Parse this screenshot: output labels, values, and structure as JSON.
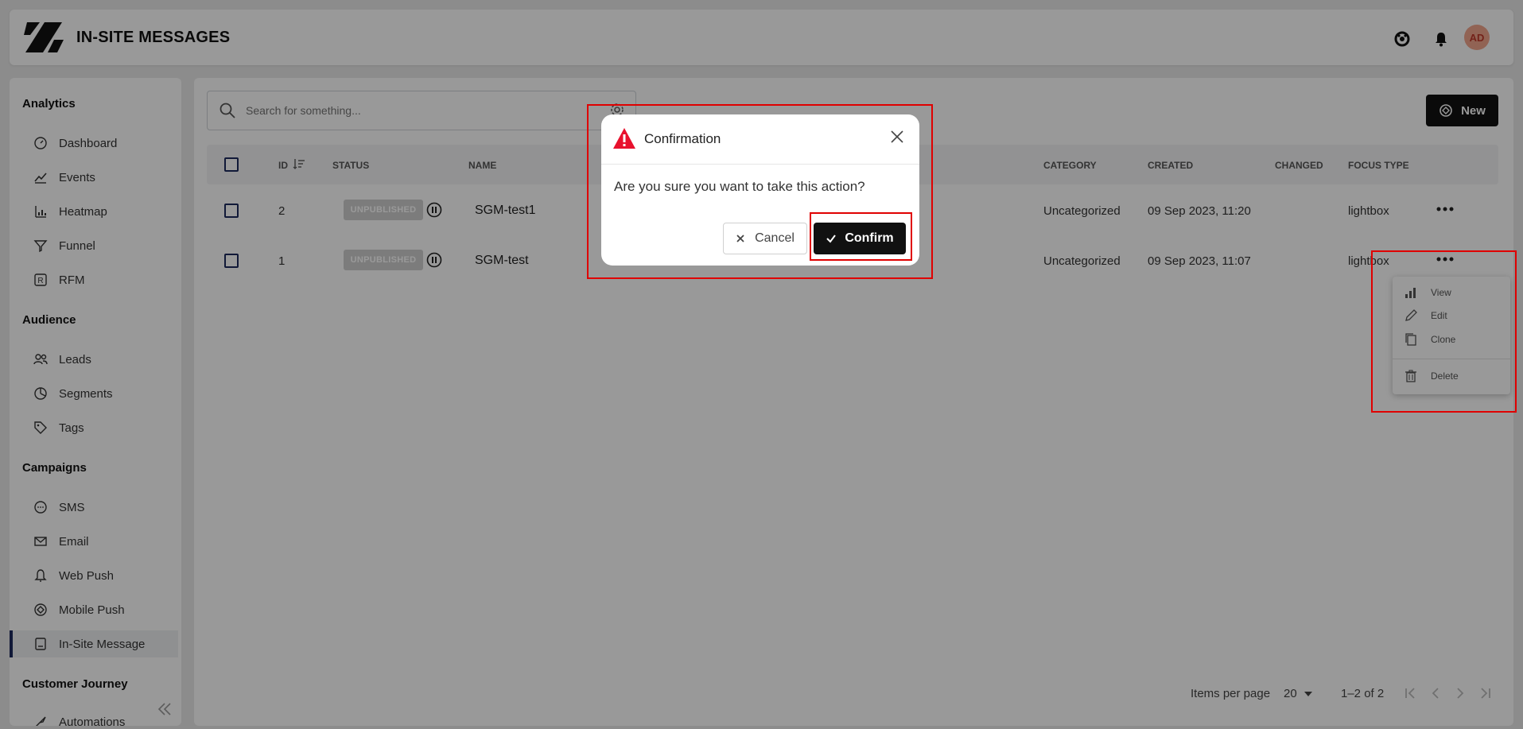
{
  "header": {
    "title": "IN-SITE MESSAGES",
    "avatar_initials": "AD"
  },
  "sidebar": {
    "sections": [
      {
        "title": "Analytics",
        "items": [
          "Dashboard",
          "Events",
          "Heatmap",
          "Funnel",
          "RFM"
        ]
      },
      {
        "title": "Audience",
        "items": [
          "Leads",
          "Segments",
          "Tags"
        ]
      },
      {
        "title": "Campaigns",
        "items": [
          "SMS",
          "Email",
          "Web Push",
          "Mobile Push",
          "In-Site Message"
        ]
      },
      {
        "title": "Customer Journey",
        "items": [
          "Automations"
        ]
      }
    ],
    "active_item": "In-Site Message"
  },
  "toolbar": {
    "search_placeholder": "Search for something...",
    "new_label": "New"
  },
  "table": {
    "columns": [
      "ID",
      "STATUS",
      "NAME",
      "CATEGORY",
      "CREATED",
      "CHANGED",
      "FOCUS TYPE"
    ],
    "rows": [
      {
        "id": "2",
        "status": "UNPUBLISHED",
        "name": "SGM-test1",
        "category": "Uncategorized",
        "created": "09 Sep 2023, 11:20",
        "changed": "",
        "focus_type": "lightbox"
      },
      {
        "id": "1",
        "status": "UNPUBLISHED",
        "name": "SGM-test",
        "category": "Uncategorized",
        "created": "09 Sep 2023, 11:07",
        "changed": "",
        "focus_type": "lightbox"
      }
    ]
  },
  "footer": {
    "items_per_page_label": "Items per page",
    "items_per_page_value": "20",
    "range_label": "1–2 of 2"
  },
  "context_menu": {
    "items": [
      "View",
      "Edit",
      "Clone",
      "Delete"
    ]
  },
  "dialog": {
    "title": "Confirmation",
    "message": "Are you sure you want to take this action?",
    "cancel_label": "Cancel",
    "confirm_label": "Confirm"
  },
  "colors": {
    "accent": "#111111",
    "highlight": "#e00000",
    "warning": "#e8112d",
    "sidebar_active_bar": "#1d2b5e"
  }
}
